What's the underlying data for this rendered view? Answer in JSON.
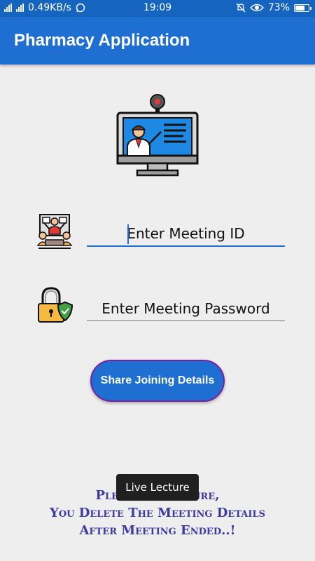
{
  "status_bar": {
    "network_speed": "0.49KB/s",
    "time": "19:09",
    "battery_percent": "73%",
    "battery_level": 0.73,
    "icons": [
      "signal-icon",
      "whatsapp-icon",
      "mute-icon",
      "eye-icon",
      "battery-icon"
    ]
  },
  "app_bar": {
    "title": "Pharmacy Application"
  },
  "hero": {
    "icon": "online-lecture-monitor-icon"
  },
  "meeting_id": {
    "icon": "meeting-group-icon",
    "placeholder": "Enter Meeting ID"
  },
  "meeting_password": {
    "icon": "padlock-shield-icon",
    "placeholder": "Enter Meeting Password"
  },
  "share_button": {
    "label": "Share Joining Details"
  },
  "note": {
    "line1": "Please Make Sure,",
    "line2": "You Delete The Meeting Details",
    "line3": "After Meeting Ended..!"
  },
  "toast": {
    "text": "Live Lecture"
  },
  "colors": {
    "primary": "#1e6fd1",
    "status_bar": "#1565c0",
    "note_text": "#3f3aa0",
    "button_border": "#7b1fa2",
    "background": "#eeeeee"
  }
}
